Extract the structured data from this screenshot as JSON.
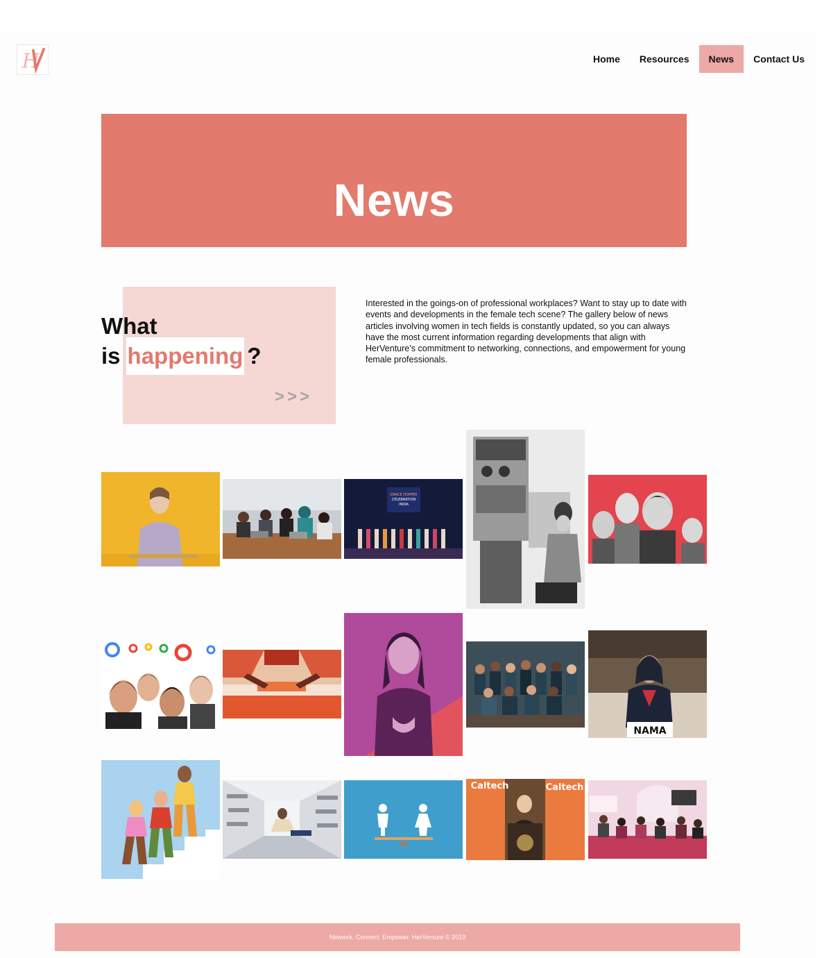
{
  "header": {
    "logo_text": "HV",
    "nav": [
      {
        "label": "Home",
        "active": false
      },
      {
        "label": "Resources",
        "active": false
      },
      {
        "label": "News",
        "active": true
      },
      {
        "label": "Contact Us",
        "active": false
      }
    ]
  },
  "hero": {
    "title": "News"
  },
  "intro": {
    "heading_line1": "What",
    "heading_is": "is",
    "heading_highlight": "happening",
    "heading_question": "?",
    "arrows": ">>>",
    "paragraph": "Interested in the goings-on of professional workplaces? Want to stay up to date with events and developments in the female tech scene? The gallery below of news articles involving women in tech fields is constantly updated, so you can always have the most current information regarding developments that align with HerVenture’s commitment to networking, connections, and empowerment for young female professionals."
  },
  "gallery": {
    "tiles": [
      {
        "caption": ""
      },
      {
        "caption": ""
      },
      {
        "caption": "GRACE HOPPER CELEBRATION INDIA"
      },
      {
        "caption": ""
      },
      {
        "caption": ""
      },
      {
        "caption": ""
      },
      {
        "caption": ""
      },
      {
        "caption": ""
      },
      {
        "caption": ""
      },
      {
        "caption": "NAMA"
      },
      {
        "caption": ""
      },
      {
        "caption": ""
      },
      {
        "caption": ""
      },
      {
        "caption": "Caltech"
      },
      {
        "caption": ""
      }
    ],
    "colors": {
      "yellow": "#f0b52a",
      "coral": "#e27a6d",
      "magenta": "#b04a9a",
      "pink_red": "#e3444d",
      "blue": "#3f9ecb",
      "orange": "#ea7a3e"
    }
  },
  "footer": {
    "text": "Network. Connect. Empower. HerVenture © 2019"
  },
  "theme": {
    "accent": "#e27a6d",
    "accent_light": "#f5d7d4",
    "nav_active": "#eda9a6"
  }
}
